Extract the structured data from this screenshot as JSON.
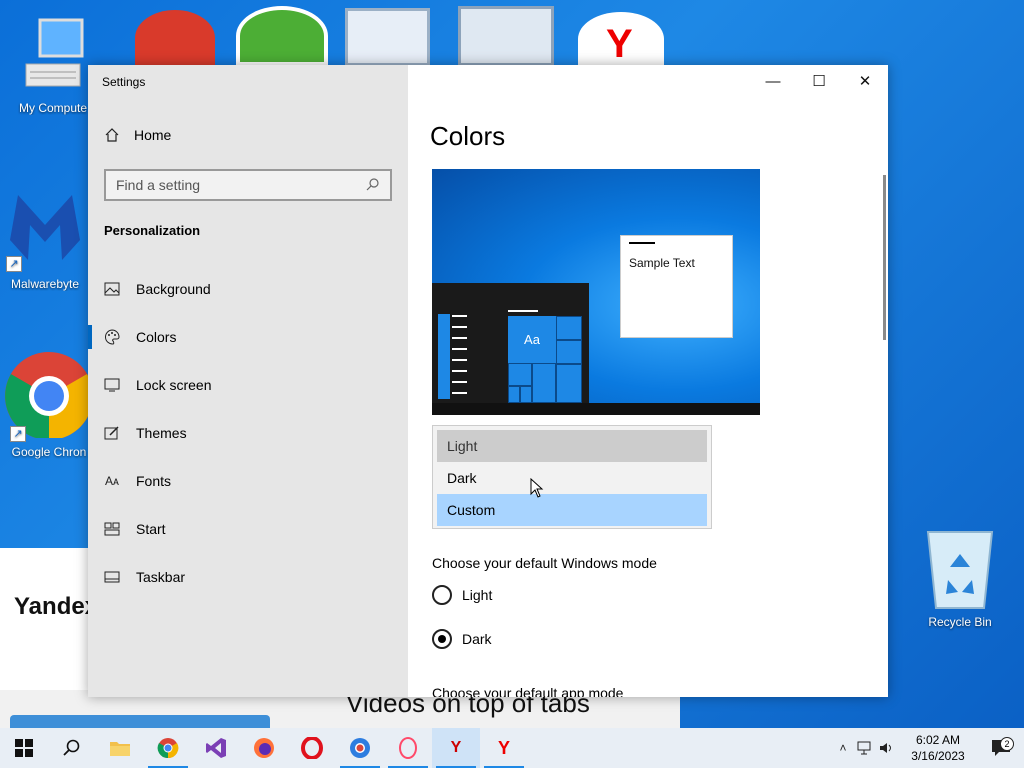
{
  "desktop": {
    "icons": [
      {
        "name": "my-computer",
        "label": "My Compute"
      },
      {
        "name": "malwarebytes",
        "label": "Malwarebyte"
      },
      {
        "name": "google-chrome",
        "label": "Google Chron"
      }
    ],
    "recycle_bin_label": "Recycle Bin",
    "background_text": {
      "yandex": "Yandex",
      "videos": "Videos on top of tabs"
    }
  },
  "window": {
    "title": "Settings",
    "controls": {
      "minimize": "—",
      "maximize": "☐",
      "close": "✕"
    }
  },
  "sidebar": {
    "home_label": "Home",
    "search_placeholder": "Find a setting",
    "section_heading": "Personalization",
    "items": [
      {
        "label": "Background",
        "icon": "picture-icon"
      },
      {
        "label": "Colors",
        "icon": "palette-icon",
        "active": true
      },
      {
        "label": "Lock screen",
        "icon": "lock-screen-icon"
      },
      {
        "label": "Themes",
        "icon": "brush-icon"
      },
      {
        "label": "Fonts",
        "icon": "font-icon"
      },
      {
        "label": "Start",
        "icon": "start-tiles-icon"
      },
      {
        "label": "Taskbar",
        "icon": "taskbar-icon"
      }
    ]
  },
  "main": {
    "page_title": "Colors",
    "preview": {
      "sample_text": "Sample Text",
      "tile_text": "Aa"
    },
    "color_dropdown": {
      "options": [
        "Light",
        "Dark",
        "Custom"
      ],
      "highlighted": "Custom",
      "hovered": "Dark"
    },
    "windows_mode": {
      "heading": "Choose your default Windows mode",
      "options": [
        {
          "label": "Light",
          "checked": false
        },
        {
          "label": "Dark",
          "checked": true
        }
      ]
    },
    "app_mode_heading": "Choose your default app mode"
  },
  "taskbar": {
    "apps": [
      "start",
      "search",
      "file-explorer",
      "chrome",
      "visual-studio",
      "firefox",
      "opera",
      "chromium",
      "opera-gx",
      "yandex-alt",
      "yandex"
    ],
    "time": "6:02 AM",
    "date": "3/16/2023",
    "notification_count": "2"
  },
  "colors": {
    "accent": "#0067c0",
    "sidebar_bg": "#e6e6e6",
    "dropdown_highlight": "#a8d4ff"
  }
}
